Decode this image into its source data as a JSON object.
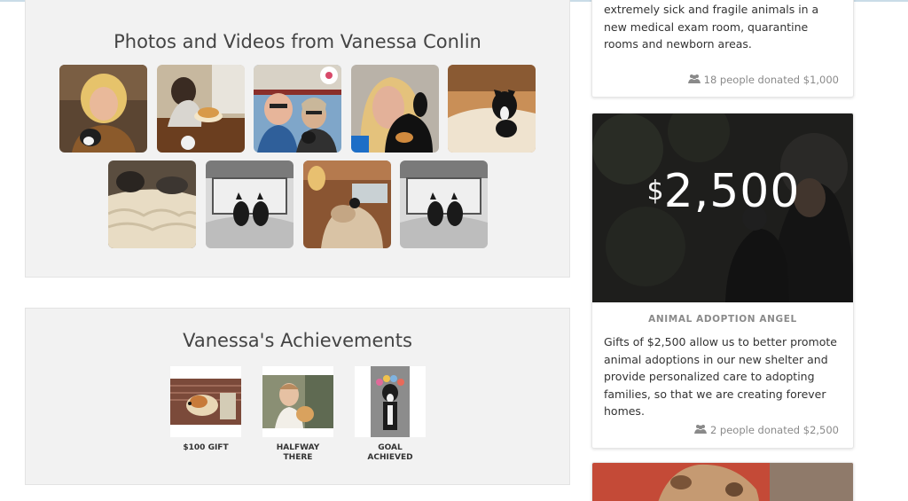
{
  "photos_section": {
    "title": "Photos and Videos from Vanessa Conlin"
  },
  "achievements_section": {
    "title": "Vanessa's Achievements",
    "items": [
      {
        "label": "$100 GIFT"
      },
      {
        "label": "HALFWAY THERE"
      },
      {
        "label": "GOAL ACHIEVED"
      }
    ]
  },
  "donation_cards": [
    {
      "description": "extremely sick and fragile animals in a new medical exam room, quarantine rooms and newborn areas.",
      "donors": "18 people donated $1,000"
    },
    {
      "currency": "$",
      "amount": "2,500",
      "level": "ANIMAL ADOPTION ANGEL",
      "description": "Gifts of $2,500 allow us to better promote animal adoptions in our new shelter and provide personalized care to adopting families, so that we are creating forever homes.",
      "donors": "2 people donated $2,500"
    }
  ],
  "icons": {
    "donors": "users-icon"
  },
  "colors": {
    "panel_bg": "#f2f2f2",
    "muted_text": "#8a8a8a",
    "text": "#333333"
  }
}
